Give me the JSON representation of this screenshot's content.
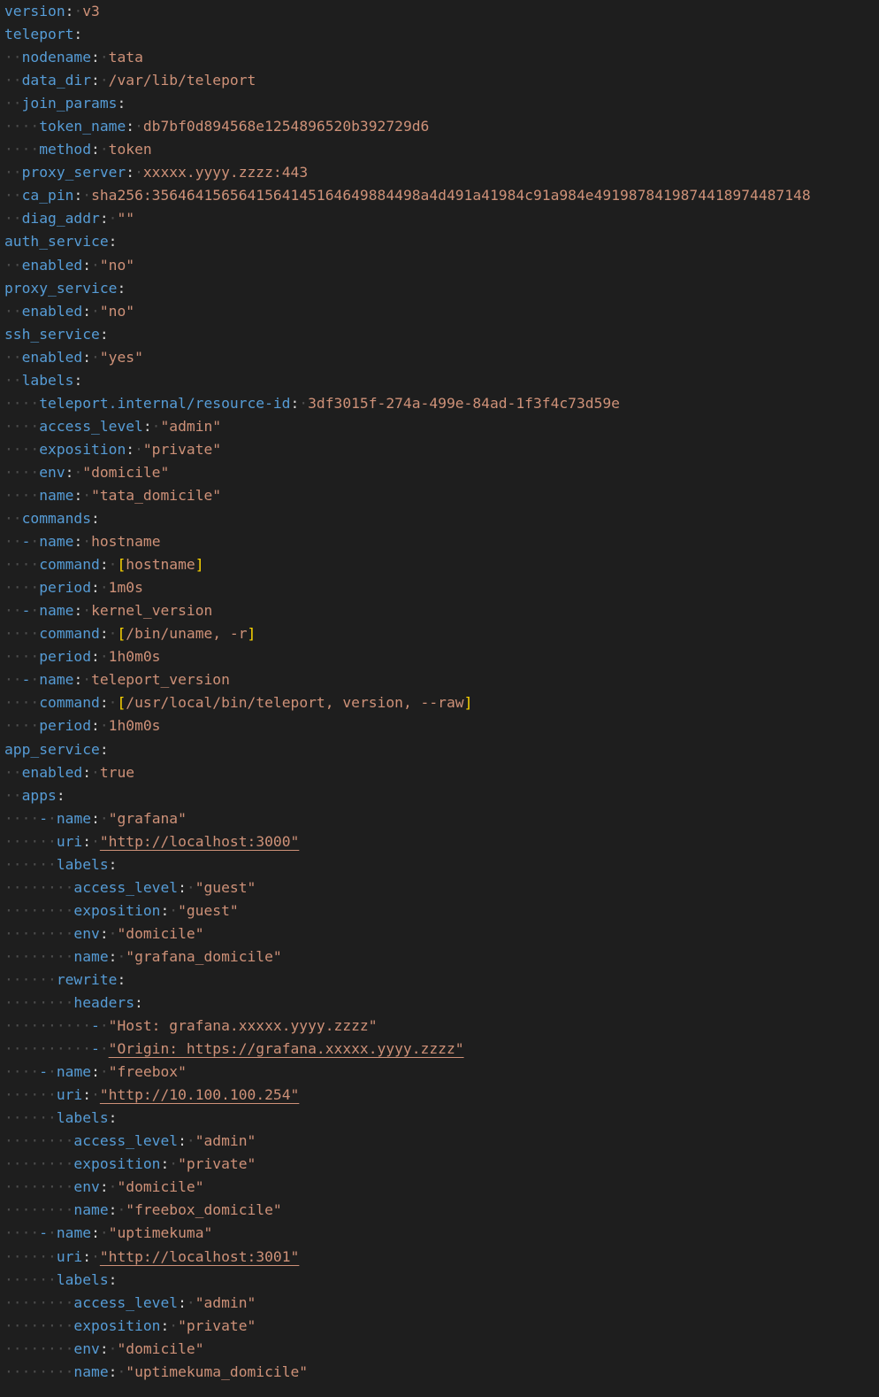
{
  "editor": {
    "language": "yaml",
    "colors": {
      "background": "#1e1e1e",
      "key": "#569cd6",
      "value": "#ce9178",
      "whitespace": "#4e4e4e",
      "bracket": "#ffd700"
    }
  },
  "lines": [
    {
      "indent": 0,
      "dash": false,
      "key": "version",
      "value": "v3"
    },
    {
      "indent": 0,
      "dash": false,
      "key": "teleport",
      "value": ""
    },
    {
      "indent": 1,
      "dash": false,
      "key": "nodename",
      "value": "tata"
    },
    {
      "indent": 1,
      "dash": false,
      "key": "data_dir",
      "value": "/var/lib/teleport"
    },
    {
      "indent": 1,
      "dash": false,
      "key": "join_params",
      "value": ""
    },
    {
      "indent": 2,
      "dash": false,
      "key": "token_name",
      "value": "db7bf0d894568e1254896520b392729d6"
    },
    {
      "indent": 2,
      "dash": false,
      "key": "method",
      "value": "token"
    },
    {
      "indent": 1,
      "dash": false,
      "key": "proxy_server",
      "value": "xxxxx.yyyy.zzzz:443"
    },
    {
      "indent": 1,
      "dash": false,
      "key": "ca_pin",
      "value": "sha256:3564641565641564145164649884498a4d491a41984c91a984e4919878419874418974487148"
    },
    {
      "indent": 1,
      "dash": false,
      "key": "diag_addr",
      "value": "\"\""
    },
    {
      "indent": 0,
      "dash": false,
      "key": "auth_service",
      "value": ""
    },
    {
      "indent": 1,
      "dash": false,
      "key": "enabled",
      "value": "\"no\""
    },
    {
      "indent": 0,
      "dash": false,
      "key": "proxy_service",
      "value": ""
    },
    {
      "indent": 1,
      "dash": false,
      "key": "enabled",
      "value": "\"no\""
    },
    {
      "indent": 0,
      "dash": false,
      "key": "ssh_service",
      "value": ""
    },
    {
      "indent": 1,
      "dash": false,
      "key": "enabled",
      "value": "\"yes\""
    },
    {
      "indent": 1,
      "dash": false,
      "key": "labels",
      "value": ""
    },
    {
      "indent": 2,
      "dash": false,
      "key": "teleport.internal/resource-id",
      "value": "3df3015f-274a-499e-84ad-1f3f4c73d59e"
    },
    {
      "indent": 2,
      "dash": false,
      "key": "access_level",
      "value": "\"admin\""
    },
    {
      "indent": 2,
      "dash": false,
      "key": "exposition",
      "value": "\"private\""
    },
    {
      "indent": 2,
      "dash": false,
      "key": "env",
      "value": "\"domicile\""
    },
    {
      "indent": 2,
      "dash": false,
      "key": "name",
      "value": "\"tata_domicile\""
    },
    {
      "indent": 1,
      "dash": false,
      "key": "commands",
      "value": ""
    },
    {
      "indent": 1,
      "dash": true,
      "key": "name",
      "value": "hostname"
    },
    {
      "indent": 2,
      "dash": false,
      "key": "command",
      "value": "[hostname]"
    },
    {
      "indent": 2,
      "dash": false,
      "key": "period",
      "value": "1m0s"
    },
    {
      "indent": 1,
      "dash": true,
      "key": "name",
      "value": "kernel_version"
    },
    {
      "indent": 2,
      "dash": false,
      "key": "command",
      "value": "[/bin/uname, -r]"
    },
    {
      "indent": 2,
      "dash": false,
      "key": "period",
      "value": "1h0m0s"
    },
    {
      "indent": 1,
      "dash": true,
      "key": "name",
      "value": "teleport_version"
    },
    {
      "indent": 2,
      "dash": false,
      "key": "command",
      "value": "[/usr/local/bin/teleport, version, --raw]"
    },
    {
      "indent": 2,
      "dash": false,
      "key": "period",
      "value": "1h0m0s"
    },
    {
      "indent": 0,
      "dash": false,
      "key": "app_service",
      "value": ""
    },
    {
      "indent": 1,
      "dash": false,
      "key": "enabled",
      "value": "true"
    },
    {
      "indent": 1,
      "dash": false,
      "key": "apps",
      "value": ""
    },
    {
      "indent": 2,
      "dash": true,
      "key": "name",
      "value": "\"grafana\""
    },
    {
      "indent": 3,
      "dash": false,
      "key": "uri",
      "value": "\"http://localhost:3000\"",
      "link": true
    },
    {
      "indent": 3,
      "dash": false,
      "key": "labels",
      "value": ""
    },
    {
      "indent": 4,
      "dash": false,
      "key": "access_level",
      "value": "\"guest\""
    },
    {
      "indent": 4,
      "dash": false,
      "key": "exposition",
      "value": "\"guest\""
    },
    {
      "indent": 4,
      "dash": false,
      "key": "env",
      "value": "\"domicile\""
    },
    {
      "indent": 4,
      "dash": false,
      "key": "name",
      "value": "\"grafana_domicile\""
    },
    {
      "indent": 3,
      "dash": false,
      "key": "rewrite",
      "value": ""
    },
    {
      "indent": 4,
      "dash": false,
      "key": "headers",
      "value": ""
    },
    {
      "indent": 5,
      "dash": true,
      "key": "",
      "value": "\"Host: grafana.xxxxx.yyyy.zzzz\""
    },
    {
      "indent": 5,
      "dash": true,
      "key": "",
      "value": "\"Origin: https://grafana.xxxxx.yyyy.zzzz\"",
      "link": true
    },
    {
      "indent": 2,
      "dash": true,
      "key": "name",
      "value": "\"freebox\""
    },
    {
      "indent": 3,
      "dash": false,
      "key": "uri",
      "value": "\"http://10.100.100.254\"",
      "link": true
    },
    {
      "indent": 3,
      "dash": false,
      "key": "labels",
      "value": ""
    },
    {
      "indent": 4,
      "dash": false,
      "key": "access_level",
      "value": "\"admin\""
    },
    {
      "indent": 4,
      "dash": false,
      "key": "exposition",
      "value": "\"private\""
    },
    {
      "indent": 4,
      "dash": false,
      "key": "env",
      "value": "\"domicile\""
    },
    {
      "indent": 4,
      "dash": false,
      "key": "name",
      "value": "\"freebox_domicile\""
    },
    {
      "indent": 2,
      "dash": true,
      "key": "name",
      "value": "\"uptimekuma\""
    },
    {
      "indent": 3,
      "dash": false,
      "key": "uri",
      "value": "\"http://localhost:3001\"",
      "link": true
    },
    {
      "indent": 3,
      "dash": false,
      "key": "labels",
      "value": ""
    },
    {
      "indent": 4,
      "dash": false,
      "key": "access_level",
      "value": "\"admin\""
    },
    {
      "indent": 4,
      "dash": false,
      "key": "exposition",
      "value": "\"private\""
    },
    {
      "indent": 4,
      "dash": false,
      "key": "env",
      "value": "\"domicile\""
    },
    {
      "indent": 4,
      "dash": false,
      "key": "name",
      "value": "\"uptimekuma_domicile\""
    }
  ]
}
